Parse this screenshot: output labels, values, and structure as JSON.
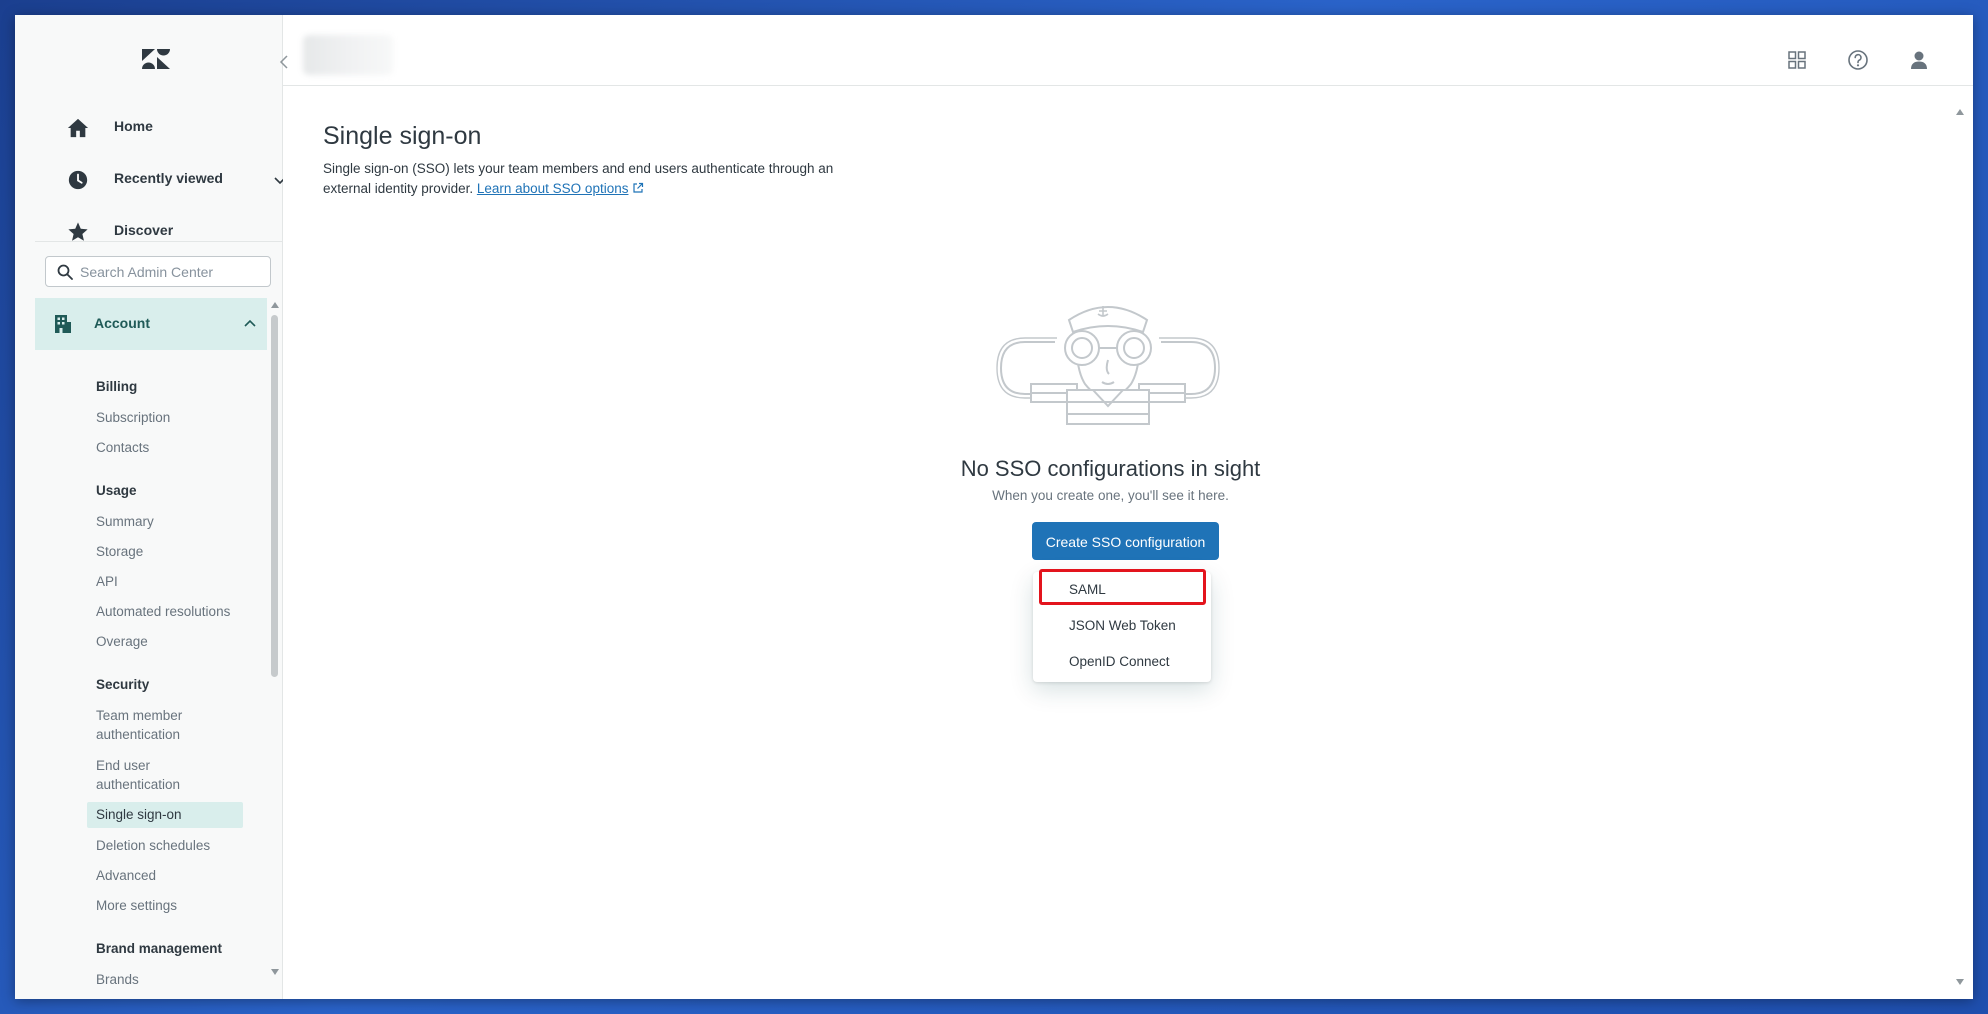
{
  "sidebar": {
    "nav": [
      {
        "label": "Home",
        "icon": "home-icon"
      },
      {
        "label": "Recently viewed",
        "icon": "clock-icon"
      },
      {
        "label": "Discover",
        "icon": "star-icon"
      }
    ],
    "search_placeholder": "Search Admin Center",
    "account": {
      "label": "Account",
      "icon": "building-icon"
    },
    "sections": [
      {
        "heading": "Billing",
        "links": [
          "Subscription",
          "Contacts"
        ]
      },
      {
        "heading": "Usage",
        "links": [
          "Summary",
          "Storage",
          "API",
          "Automated resolutions",
          "Overage"
        ]
      },
      {
        "heading": "Security",
        "links": [
          "Team member authentication",
          "End user authentication",
          "Single sign-on",
          "Deletion schedules",
          "Advanced",
          "More settings"
        ]
      },
      {
        "heading": "Brand management",
        "links": [
          "Brands"
        ]
      }
    ],
    "active_link": "Single sign-on"
  },
  "topbar": {
    "icons": [
      "products-grid-icon",
      "help-icon",
      "user-profile-icon"
    ]
  },
  "main": {
    "title": "Single sign-on",
    "description": "Single sign-on (SSO) lets your team members and end users authenticate through an external identity provider.",
    "learn_link": "Learn about SSO options",
    "empty_title": "No SSO configurations in sight",
    "empty_subtitle": "When you create one, you'll see it here.",
    "create_button": "Create SSO configuration",
    "dropdown_items": [
      "SAML",
      "JSON Web Token",
      "OpenID Connect"
    ],
    "highlighted_item": "SAML"
  },
  "colors": {
    "brand_blue": "#1f73b7",
    "active_bg": "#d9eeec",
    "highlight_red": "#e3141d"
  }
}
